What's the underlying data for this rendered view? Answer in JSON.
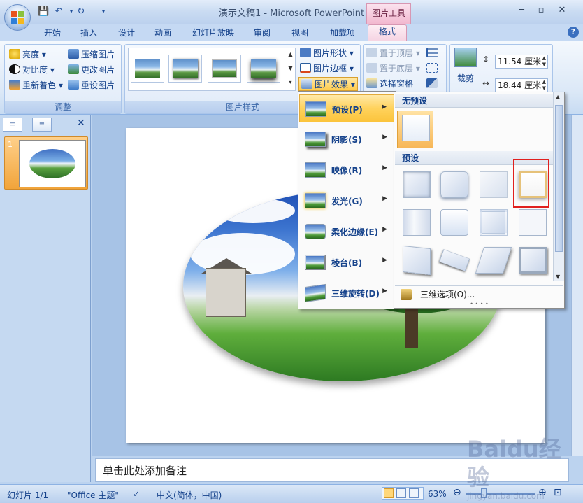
{
  "window": {
    "title": "演示文稿1 - Microsoft PowerPoint",
    "context_tab_group": "图片工具"
  },
  "tabs": [
    "开始",
    "插入",
    "设计",
    "动画",
    "幻灯片放映",
    "审阅",
    "视图",
    "加载项",
    "格式"
  ],
  "ribbon": {
    "adjust": {
      "label": "调整",
      "items": [
        "亮度",
        "对比度",
        "重新着色",
        "压缩图片",
        "更改图片",
        "重设图片"
      ]
    },
    "styles": {
      "label": "图片样式",
      "shape": "图片形状",
      "border": "图片边框",
      "effects": "图片效果"
    },
    "arrange": {
      "bring_front": "置于顶层",
      "send_back": "置于底层",
      "selection_pane": "选择窗格"
    },
    "size": {
      "crop": "裁剪",
      "height": "11.54 厘米",
      "width": "18.44 厘米"
    }
  },
  "slide_pane": {
    "slide_number": "1"
  },
  "effects_menu": {
    "items": [
      "预设(P)",
      "阴影(S)",
      "映像(R)",
      "发光(G)",
      "柔化边缘(E)",
      "棱台(B)",
      "三维旋转(D)"
    ]
  },
  "preset_panel": {
    "no_preset": "无预设",
    "preset": "预设",
    "options": "三维选项(O)..."
  },
  "notes": {
    "placeholder": "单击此处添加备注"
  },
  "status": {
    "slide": "幻灯片 1/1",
    "theme": "\"Office 主题\"",
    "language": "中文(简体，中国)",
    "zoom": "63%"
  },
  "watermark": {
    "brand": "Baidu经验",
    "url": "jingyan.baidu.com"
  }
}
